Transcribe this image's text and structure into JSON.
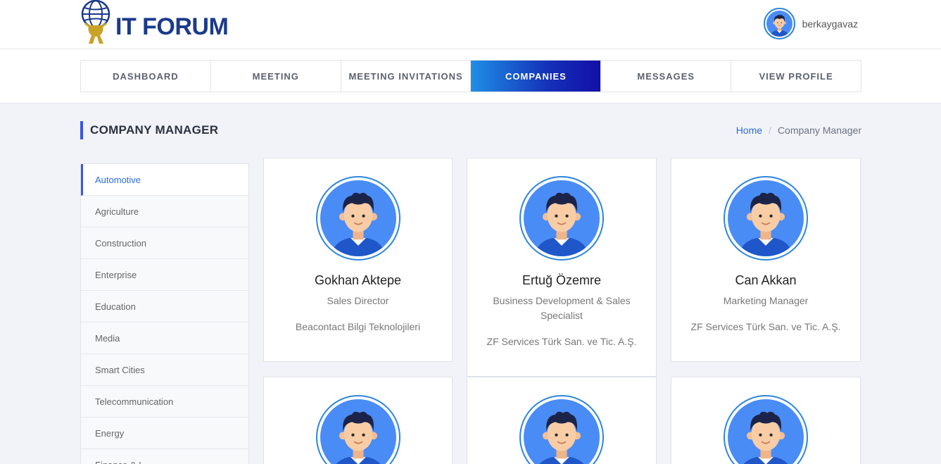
{
  "app": {
    "logo_text": "IT FORUM",
    "username": "berkaygavaz"
  },
  "nav": {
    "items": [
      {
        "label": "DASHBOARD",
        "active": false
      },
      {
        "label": "MEETING",
        "active": false
      },
      {
        "label": "MEETING INVITATIONS",
        "active": false
      },
      {
        "label": "COMPANIES",
        "active": true
      },
      {
        "label": "MESSAGES",
        "active": false
      },
      {
        "label": "VIEW PROFILE",
        "active": false
      }
    ]
  },
  "page": {
    "title": "COMPANY MANAGER",
    "breadcrumb": {
      "home": "Home",
      "separator": "/",
      "current": "Company Manager"
    }
  },
  "sidebar": {
    "items": [
      {
        "label": "Automotive",
        "active": true
      },
      {
        "label": "Agriculture",
        "active": false
      },
      {
        "label": "Construction",
        "active": false
      },
      {
        "label": "Enterprise",
        "active": false
      },
      {
        "label": "Education",
        "active": false
      },
      {
        "label": "Media",
        "active": false
      },
      {
        "label": "Smart Cities",
        "active": false
      },
      {
        "label": "Telecommunication",
        "active": false
      },
      {
        "label": "Energy",
        "active": false
      },
      {
        "label": "Finance & I...",
        "active": false
      }
    ]
  },
  "cards": [
    {
      "name": "Gokhan Aktepe",
      "title": "Sales Director",
      "company": "Beacontact Bilgi Teknolojileri"
    },
    {
      "name": "Ertuğ Özemre",
      "title": "Business Development & Sales Specialist",
      "company": "ZF Services Türk San. ve Tic. A.Ş."
    },
    {
      "name": "Can Akkan",
      "title": "Marketing Manager",
      "company": "ZF Services Türk San. ve Tic. A.Ş."
    },
    {
      "name": "",
      "title": "",
      "company": ""
    },
    {
      "name": "",
      "title": "",
      "company": ""
    },
    {
      "name": "",
      "title": "",
      "company": ""
    }
  ],
  "colors": {
    "accent": "#3a56e6",
    "link": "#2a6fd6",
    "nav_active_start": "#1f8fe6",
    "nav_active_end": "#130fa8",
    "avatar_ring": "#2f86dd",
    "avatar_bg": "#4a8cf5",
    "logo_text": "#1b3a8c"
  },
  "icons": {
    "logo": "atlas-globe-icon",
    "avatar": "user-avatar-icon"
  }
}
